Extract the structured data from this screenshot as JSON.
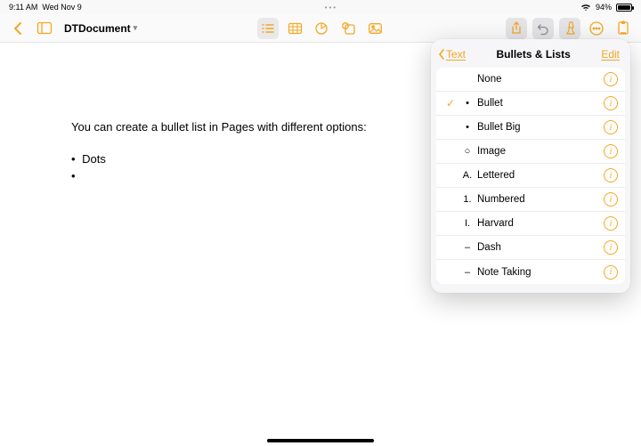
{
  "status": {
    "time": "9:11 AM",
    "date": "Wed Nov 9",
    "battery_pct": "94%"
  },
  "toolbar": {
    "doc_title": "DTDocument"
  },
  "document": {
    "intro": "You can create a bullet list in Pages with different options:",
    "items": [
      "Dots",
      ""
    ]
  },
  "popover": {
    "back_label": "Text",
    "title": "Bullets & Lists",
    "edit_label": "Edit",
    "rows": [
      {
        "marker": "",
        "label": "None",
        "selected": false
      },
      {
        "marker": "•",
        "label": "Bullet",
        "selected": true
      },
      {
        "marker": "•",
        "label": "Bullet Big",
        "selected": false
      },
      {
        "marker": "○",
        "label": "Image",
        "selected": false
      },
      {
        "marker": "A.",
        "label": "Lettered",
        "selected": false
      },
      {
        "marker": "1.",
        "label": "Numbered",
        "selected": false
      },
      {
        "marker": "I.",
        "label": "Harvard",
        "selected": false
      },
      {
        "marker": "–",
        "label": "Dash",
        "selected": false
      },
      {
        "marker": "–",
        "label": "Note Taking",
        "selected": false
      }
    ]
  }
}
